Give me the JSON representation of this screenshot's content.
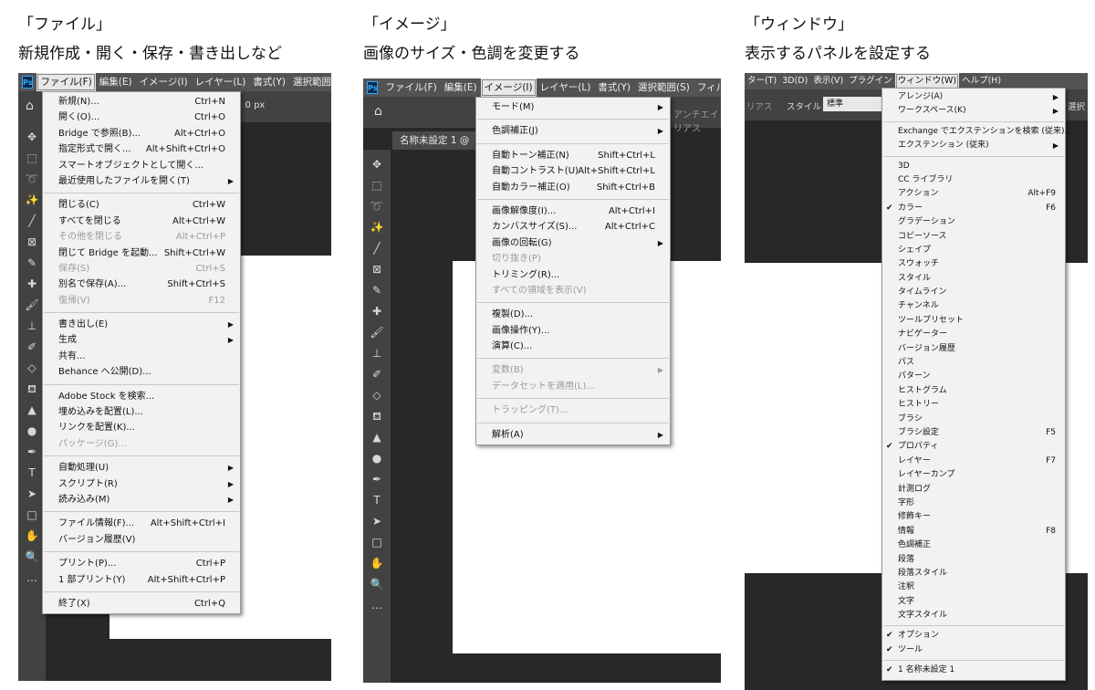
{
  "panels": [
    {
      "heading": "「ファイル」",
      "subheading": "新規作成・開く・保存・書き出しなど",
      "menubar": [
        "Ps",
        "ファイル(F)",
        "編集(E)",
        "イメージ(I)",
        "レイヤー(L)",
        "書式(Y)",
        "選択範囲(S)"
      ],
      "options_text": ": 0 px",
      "menu": [
        {
          "label": "新規(N)...",
          "shortcut": "Ctrl+N"
        },
        {
          "label": "開く(O)...",
          "shortcut": "Ctrl+O"
        },
        {
          "label": "Bridge で参照(B)...",
          "shortcut": "Alt+Ctrl+O"
        },
        {
          "label": "指定形式で開く...",
          "shortcut": "Alt+Shift+Ctrl+O"
        },
        {
          "label": "スマートオブジェクトとして開く..."
        },
        {
          "label": "最近使用したファイルを開く(T)",
          "submenu": true
        },
        {
          "sep": true
        },
        {
          "label": "閉じる(C)",
          "shortcut": "Ctrl+W"
        },
        {
          "label": "すべてを閉じる",
          "shortcut": "Alt+Ctrl+W"
        },
        {
          "label": "その他を閉じる",
          "shortcut": "Alt+Ctrl+P",
          "disabled": true
        },
        {
          "label": "閉じて Bridge を起動...",
          "shortcut": "Shift+Ctrl+W"
        },
        {
          "label": "保存(S)",
          "shortcut": "Ctrl+S",
          "disabled": true
        },
        {
          "label": "別名で保存(A)...",
          "shortcut": "Shift+Ctrl+S"
        },
        {
          "label": "復帰(V)",
          "shortcut": "F12",
          "disabled": true
        },
        {
          "sep": true
        },
        {
          "label": "書き出し(E)",
          "submenu": true
        },
        {
          "label": "生成",
          "submenu": true
        },
        {
          "label": "共有..."
        },
        {
          "label": "Behance へ公開(D)..."
        },
        {
          "sep": true
        },
        {
          "label": "Adobe Stock を検索..."
        },
        {
          "label": "埋め込みを配置(L)..."
        },
        {
          "label": "リンクを配置(K)..."
        },
        {
          "label": "パッケージ(G)...",
          "disabled": true
        },
        {
          "sep": true
        },
        {
          "label": "自動処理(U)",
          "submenu": true
        },
        {
          "label": "スクリプト(R)",
          "submenu": true
        },
        {
          "label": "読み込み(M)",
          "submenu": true
        },
        {
          "sep": true
        },
        {
          "label": "ファイル情報(F)...",
          "shortcut": "Alt+Shift+Ctrl+I"
        },
        {
          "label": "バージョン履歴(V)"
        },
        {
          "sep": true
        },
        {
          "label": "プリント(P)...",
          "shortcut": "Ctrl+P"
        },
        {
          "label": "1 部プリント(Y)",
          "shortcut": "Alt+Shift+Ctrl+P"
        },
        {
          "sep": true
        },
        {
          "label": "終了(X)",
          "shortcut": "Ctrl+Q"
        }
      ]
    },
    {
      "heading": "「イメージ」",
      "subheading": "画像のサイズ・色調を変更する",
      "menubar": [
        "Ps",
        "ファイル(F)",
        "編集(E)",
        "イメージ(I)",
        "レイヤー(L)",
        "書式(Y)",
        "選択範囲(S)",
        "フィルター("
      ],
      "tab_label": "名称未設定 1 @",
      "options_text": "アンチエイリアス",
      "menu": [
        {
          "label": "モード(M)",
          "submenu": true
        },
        {
          "sep": true
        },
        {
          "label": "色調補正(J)",
          "submenu": true
        },
        {
          "sep": true
        },
        {
          "label": "自動トーン補正(N)",
          "shortcut": "Shift+Ctrl+L"
        },
        {
          "label": "自動コントラスト(U)",
          "shortcut": "Alt+Shift+Ctrl+L"
        },
        {
          "label": "自動カラー補正(O)",
          "shortcut": "Shift+Ctrl+B"
        },
        {
          "sep": true
        },
        {
          "label": "画像解像度(I)...",
          "shortcut": "Alt+Ctrl+I"
        },
        {
          "label": "カンバスサイズ(S)...",
          "shortcut": "Alt+Ctrl+C"
        },
        {
          "label": "画像の回転(G)",
          "submenu": true
        },
        {
          "label": "切り抜き(P)",
          "disabled": true
        },
        {
          "label": "トリミング(R)..."
        },
        {
          "label": "すべての領域を表示(V)",
          "disabled": true
        },
        {
          "sep": true
        },
        {
          "label": "複製(D)..."
        },
        {
          "label": "画像操作(Y)..."
        },
        {
          "label": "演算(C)..."
        },
        {
          "sep": true
        },
        {
          "label": "変数(B)",
          "submenu": true,
          "disabled": true
        },
        {
          "label": "データセットを適用(L)...",
          "disabled": true
        },
        {
          "sep": true
        },
        {
          "label": "トラッピング(T)...",
          "disabled": true
        },
        {
          "sep": true
        },
        {
          "label": "解析(A)",
          "submenu": true
        }
      ]
    },
    {
      "heading": "「ウィンドウ」",
      "subheading": "表示するパネルを設定する",
      "menubar": [
        "ター(T)",
        "3D(D)",
        "表示(V)",
        "プラグイン",
        "ウィンドウ(W)",
        "ヘルプ(H)"
      ],
      "options_label": "スタイル：",
      "options_select": "標準",
      "options_left": "リアス",
      "options_right": "選択",
      "menu": [
        {
          "label": "アレンジ(A)",
          "submenu": true
        },
        {
          "label": "ワークスペース(K)",
          "submenu": true
        },
        {
          "sep": true
        },
        {
          "label": "Exchange でエクステンションを検索 (従来)..."
        },
        {
          "label": "エクステンション (従来)",
          "submenu": true
        },
        {
          "sep": true
        },
        {
          "label": "3D"
        },
        {
          "label": "CC ライブラリ"
        },
        {
          "label": "アクション",
          "shortcut": "Alt+F9"
        },
        {
          "label": "カラー",
          "shortcut": "F6",
          "checked": true
        },
        {
          "label": "グラデーション"
        },
        {
          "label": "コピーソース"
        },
        {
          "label": "シェイプ"
        },
        {
          "label": "スウォッチ"
        },
        {
          "label": "スタイル"
        },
        {
          "label": "タイムライン"
        },
        {
          "label": "チャンネル"
        },
        {
          "label": "ツールプリセット"
        },
        {
          "label": "ナビゲーター"
        },
        {
          "label": "バージョン履歴"
        },
        {
          "label": "パス"
        },
        {
          "label": "パターン"
        },
        {
          "label": "ヒストグラム"
        },
        {
          "label": "ヒストリー"
        },
        {
          "label": "ブラシ"
        },
        {
          "label": "ブラシ設定",
          "shortcut": "F5"
        },
        {
          "label": "プロパティ",
          "checked": true
        },
        {
          "label": "レイヤー",
          "shortcut": "F7"
        },
        {
          "label": "レイヤーカンプ"
        },
        {
          "label": "計測ログ"
        },
        {
          "label": "字形"
        },
        {
          "label": "修飾キー"
        },
        {
          "label": "情報",
          "shortcut": "F8"
        },
        {
          "label": "色調補正"
        },
        {
          "label": "段落"
        },
        {
          "label": "段落スタイル"
        },
        {
          "label": "注釈"
        },
        {
          "label": "文字"
        },
        {
          "label": "文字スタイル"
        },
        {
          "sep": true
        },
        {
          "label": "オプション",
          "checked": true
        },
        {
          "label": "ツール",
          "checked": true
        },
        {
          "sep": true
        },
        {
          "label": "1 名称未設定 1",
          "checked": true
        }
      ]
    }
  ],
  "toolbar_icons": [
    "move-icon",
    "marquee-icon",
    "lasso-icon",
    "magic-wand-icon",
    "brush-small-icon",
    "frame-icon",
    "eyedropper-icon",
    "healing-icon",
    "brush-icon",
    "stamp-icon",
    "history-brush-icon",
    "eraser-icon",
    "bucket-icon",
    "triangle-icon",
    "dodge-icon",
    "pen-icon",
    "text-icon",
    "path-select-icon",
    "rectangle-icon",
    "hand-icon",
    "zoom-icon",
    "more-icon"
  ],
  "toolbar_glyphs": [
    "✥",
    "⬚",
    "➰",
    "✨",
    "╱",
    "⊠",
    "✎",
    "✚",
    "🖌",
    "⊥",
    "✐",
    "◇",
    "⛾",
    "▲",
    "●",
    "✒",
    "T",
    "➤",
    "□",
    "✋",
    "🔍",
    "…"
  ]
}
